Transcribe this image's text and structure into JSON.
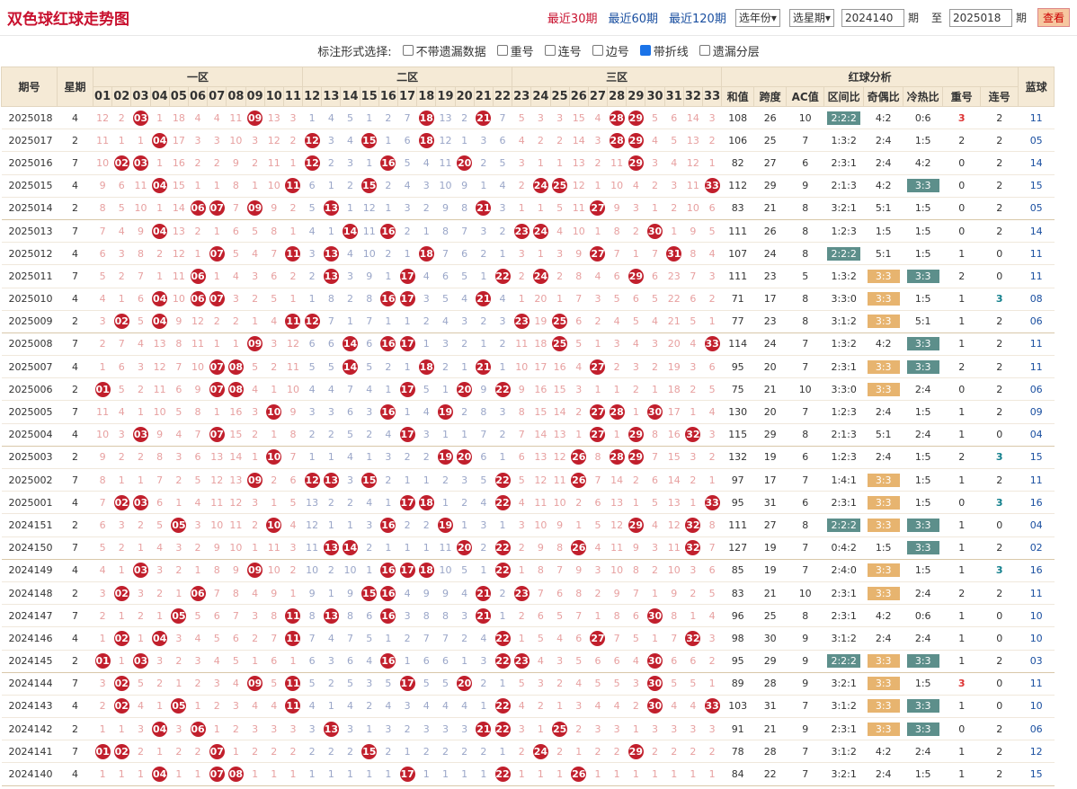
{
  "header": {
    "title": "双色球红球走势图",
    "links": [
      "最近30期",
      "最近60期",
      "最近120期"
    ],
    "year_select": "选年份",
    "star_select": "选星期",
    "from": "2024140",
    "from_unit": "期",
    "to_label": "至",
    "to": "2025018",
    "to_unit": "期",
    "query": "查看"
  },
  "options": {
    "label": "标注形式选择:",
    "items": [
      {
        "t": "不带遗漏数据",
        "on": false
      },
      {
        "t": "重号",
        "on": false
      },
      {
        "t": "连号",
        "on": false
      },
      {
        "t": "边号",
        "on": false
      },
      {
        "t": "带折线",
        "on": true
      },
      {
        "t": "遗漏分层",
        "on": false
      }
    ]
  },
  "cols": {
    "period": "期号",
    "week": "星期",
    "z1": "一区",
    "z2": "二区",
    "z3": "三区",
    "ana": "红球分析",
    "blue": "蓝球",
    "sum": "和值",
    "span": "跨度",
    "ac": "AC值",
    "zone": "区间比",
    "oe": "奇偶比",
    "hc": "冷热比",
    "rep": "重号",
    "con": "连号"
  },
  "colors": {
    "ball": "#c11f2c",
    "head": "#f5ead6",
    "tag_green": "#5d8f8b",
    "tag_orange": "#e7b46f"
  },
  "rows": [
    [
      "2025018",
      "4",
      [
        3,
        9,
        18,
        21,
        28,
        29
      ],
      [
        "108",
        "26",
        "10",
        "2:2:2",
        "4:2",
        "0:6",
        "3",
        "2",
        "11"
      ]
    ],
    [
      "2025017",
      "2",
      [
        4,
        12,
        15,
        18,
        28,
        29
      ],
      [
        "106",
        "25",
        "7",
        "1:3:2",
        "2:4",
        "1:5",
        "2",
        "2",
        "05"
      ]
    ],
    [
      "2025016",
      "7",
      [
        2,
        3,
        12,
        16,
        20,
        29
      ],
      [
        "82",
        "27",
        "6",
        "2:3:1",
        "2:4",
        "4:2",
        "0",
        "2",
        "14"
      ]
    ],
    [
      "2025015",
      "4",
      [
        4,
        11,
        15,
        24,
        25,
        33
      ],
      [
        "112",
        "29",
        "9",
        "2:1:3",
        "4:2",
        "3:3",
        "0",
        "2",
        "15"
      ]
    ],
    [
      "2025014",
      "2",
      [
        6,
        7,
        9,
        13,
        21,
        27
      ],
      [
        "83",
        "21",
        "8",
        "3:2:1",
        "5:1",
        "1:5",
        "0",
        "2",
        "05"
      ]
    ],
    [
      "2025013",
      "7",
      [
        4,
        14,
        16,
        23,
        24,
        30
      ],
      [
        "111",
        "26",
        "8",
        "1:2:3",
        "1:5",
        "1:5",
        "0",
        "2",
        "14"
      ]
    ],
    [
      "2025012",
      "4",
      [
        7,
        11,
        13,
        18,
        27,
        31
      ],
      [
        "107",
        "24",
        "8",
        "2:2:2",
        "5:1",
        "1:5",
        "1",
        "0",
        "11"
      ]
    ],
    [
      "2025011",
      "7",
      [
        6,
        13,
        17,
        22,
        24,
        29
      ],
      [
        "111",
        "23",
        "5",
        "1:3:2",
        "3:3",
        "3:3",
        "2",
        "0",
        "11"
      ]
    ],
    [
      "2025010",
      "4",
      [
        4,
        6,
        7,
        16,
        17,
        21
      ],
      [
        "71",
        "17",
        "8",
        "3:3:0",
        "3:3",
        "1:5",
        "1",
        "3",
        "08"
      ]
    ],
    [
      "2025009",
      "2",
      [
        2,
        4,
        11,
        12,
        23,
        25
      ],
      [
        "77",
        "23",
        "8",
        "3:1:2",
        "3:3",
        "5:1",
        "1",
        "2",
        "06"
      ]
    ],
    [
      "2025008",
      "7",
      [
        9,
        14,
        16,
        17,
        25,
        33
      ],
      [
        "114",
        "24",
        "7",
        "1:3:2",
        "4:2",
        "3:3",
        "1",
        "2",
        "11"
      ]
    ],
    [
      "2025007",
      "4",
      [
        7,
        8,
        14,
        18,
        21,
        27
      ],
      [
        "95",
        "20",
        "7",
        "2:3:1",
        "3:3",
        "3:3",
        "2",
        "2",
        "11"
      ]
    ],
    [
      "2025006",
      "2",
      [
        1,
        7,
        8,
        17,
        20,
        22
      ],
      [
        "75",
        "21",
        "10",
        "3:3:0",
        "3:3",
        "2:4",
        "0",
        "2",
        "06"
      ]
    ],
    [
      "2025005",
      "7",
      [
        10,
        16,
        19,
        27,
        28,
        30
      ],
      [
        "130",
        "20",
        "7",
        "1:2:3",
        "2:4",
        "1:5",
        "1",
        "2",
        "09"
      ]
    ],
    [
      "2025004",
      "4",
      [
        3,
        7,
        17,
        27,
        29,
        32
      ],
      [
        "115",
        "29",
        "8",
        "2:1:3",
        "5:1",
        "2:4",
        "1",
        "0",
        "04"
      ]
    ],
    [
      "2025003",
      "2",
      [
        10,
        19,
        20,
        26,
        28,
        29
      ],
      [
        "132",
        "19",
        "6",
        "1:2:3",
        "2:4",
        "1:5",
        "2",
        "3",
        "15"
      ]
    ],
    [
      "2025002",
      "7",
      [
        9,
        12,
        13,
        15,
        22,
        26
      ],
      [
        "97",
        "17",
        "7",
        "1:4:1",
        "3:3",
        "1:5",
        "1",
        "2",
        "11"
      ]
    ],
    [
      "2025001",
      "4",
      [
        2,
        3,
        17,
        18,
        22,
        33
      ],
      [
        "95",
        "31",
        "6",
        "2:3:1",
        "3:3",
        "1:5",
        "0",
        "3",
        "16"
      ]
    ],
    [
      "2024151",
      "2",
      [
        5,
        10,
        16,
        19,
        29,
        32
      ],
      [
        "111",
        "27",
        "8",
        "2:2:2",
        "3:3",
        "3:3",
        "1",
        "0",
        "04"
      ]
    ],
    [
      "2024150",
      "7",
      [
        13,
        14,
        20,
        22,
        26,
        32
      ],
      [
        "127",
        "19",
        "7",
        "0:4:2",
        "1:5",
        "3:3",
        "1",
        "2",
        "02"
      ]
    ],
    [
      "2024149",
      "4",
      [
        3,
        9,
        16,
        17,
        18,
        22
      ],
      [
        "85",
        "19",
        "7",
        "2:4:0",
        "3:3",
        "1:5",
        "1",
        "3",
        "16"
      ]
    ],
    [
      "2024148",
      "2",
      [
        2,
        6,
        15,
        16,
        21,
        23
      ],
      [
        "83",
        "21",
        "10",
        "2:3:1",
        "3:3",
        "2:4",
        "2",
        "2",
        "11"
      ]
    ],
    [
      "2024147",
      "7",
      [
        5,
        11,
        13,
        16,
        21,
        30
      ],
      [
        "96",
        "25",
        "8",
        "2:3:1",
        "4:2",
        "0:6",
        "1",
        "0",
        "10"
      ]
    ],
    [
      "2024146",
      "4",
      [
        2,
        4,
        11,
        22,
        27,
        32
      ],
      [
        "98",
        "30",
        "9",
        "3:1:2",
        "2:4",
        "2:4",
        "1",
        "0",
        "10"
      ]
    ],
    [
      "2024145",
      "2",
      [
        1,
        3,
        16,
        22,
        23,
        30
      ],
      [
        "95",
        "29",
        "9",
        "2:2:2",
        "3:3",
        "3:3",
        "1",
        "2",
        "03"
      ]
    ],
    [
      "2024144",
      "7",
      [
        2,
        9,
        11,
        17,
        20,
        30
      ],
      [
        "89",
        "28",
        "9",
        "3:2:1",
        "3:3",
        "1:5",
        "3",
        "0",
        "11"
      ]
    ],
    [
      "2024143",
      "4",
      [
        2,
        5,
        11,
        22,
        30,
        33
      ],
      [
        "103",
        "31",
        "7",
        "3:1:2",
        "3:3",
        "3:3",
        "1",
        "0",
        "10"
      ]
    ],
    [
      "2024142",
      "2",
      [
        4,
        6,
        13,
        21,
        22,
        25
      ],
      [
        "91",
        "21",
        "9",
        "2:3:1",
        "3:3",
        "3:3",
        "0",
        "2",
        "06"
      ]
    ],
    [
      "2024141",
      "7",
      [
        1,
        2,
        7,
        15,
        24,
        29
      ],
      [
        "78",
        "28",
        "7",
        "3:1:2",
        "4:2",
        "2:4",
        "1",
        "2",
        "12"
      ]
    ],
    [
      "2024140",
      "4",
      [
        4,
        7,
        8,
        17,
        22,
        26
      ],
      [
        "84",
        "22",
        "7",
        "3:2:1",
        "2:4",
        "1:5",
        "1",
        "2",
        "15"
      ]
    ]
  ]
}
